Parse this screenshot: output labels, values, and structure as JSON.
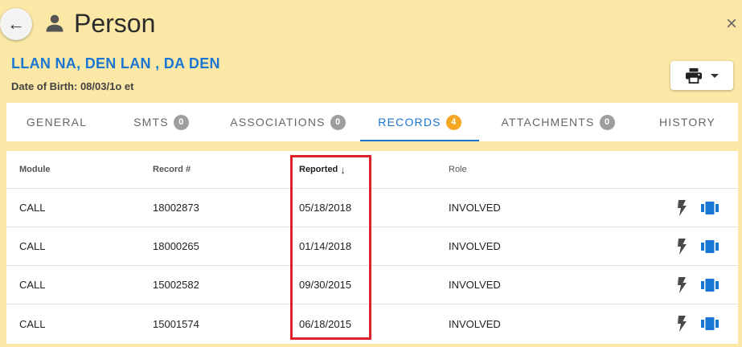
{
  "header": {
    "back_icon": "←",
    "title": "Person",
    "close_icon": "×"
  },
  "person": {
    "name": "LLAN NA, DEN LAN , DA DEN",
    "dob": "Date of Birth: 08/03/1o et"
  },
  "tabs": [
    {
      "label": "GENERAL",
      "badge": null,
      "active": false
    },
    {
      "label": "SMTS",
      "badge": "0",
      "active": false
    },
    {
      "label": "ASSOCIATIONS",
      "badge": "0",
      "active": false
    },
    {
      "label": "RECORDS",
      "badge": "4",
      "active": true
    },
    {
      "label": "ATTACHMENTS",
      "badge": "0",
      "active": false
    },
    {
      "label": "HISTORY",
      "badge": null,
      "active": false
    }
  ],
  "table": {
    "columns": {
      "module": "Module",
      "record": "Record #",
      "reported": "Reported",
      "role": "Role",
      "sort_icon": "↓"
    },
    "rows": [
      {
        "module": "CALL",
        "record": "18002873",
        "reported": "05/18/2018",
        "role": "INVOLVED"
      },
      {
        "module": "CALL",
        "record": "18000265",
        "reported": "01/14/2018",
        "role": "INVOLVED"
      },
      {
        "module": "CALL",
        "record": "15002582",
        "reported": "09/30/2015",
        "role": "INVOLVED"
      },
      {
        "module": "CALL",
        "record": "15001574",
        "reported": "06/18/2015",
        "role": "INVOLVED"
      }
    ]
  },
  "colors": {
    "background": "#fce8a6",
    "accent": "#1976d2",
    "badge_active": "#f5a623",
    "badge_inactive": "#9e9e9e",
    "highlight": "#e0212b"
  }
}
